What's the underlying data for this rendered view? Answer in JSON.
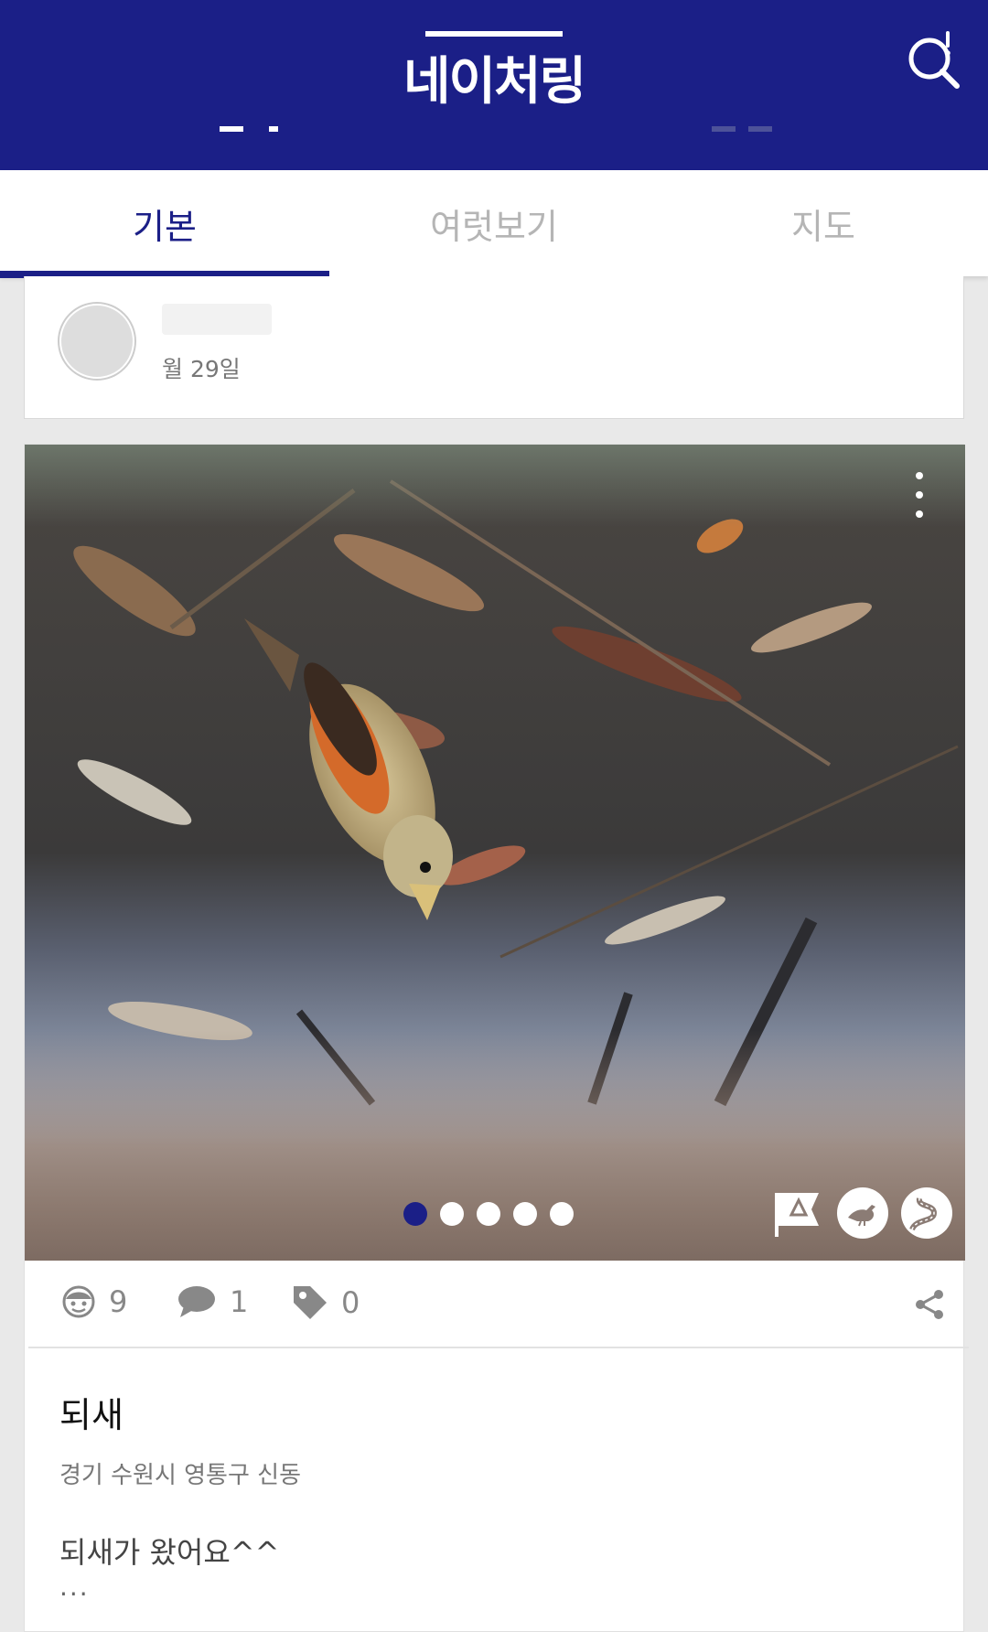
{
  "header": {
    "logo_text": "네이처링",
    "search_label": "search"
  },
  "tabs": [
    {
      "label": "기본",
      "active": true
    },
    {
      "label": "여럿보기",
      "active": false
    },
    {
      "label": "지도",
      "active": false
    }
  ],
  "author": {
    "date": "월 29일"
  },
  "post": {
    "species": "되새",
    "location": "경기 수원시 영통구 신동",
    "description": "되새가 왔어요^^",
    "ellipsis": "...",
    "photo_count": 5,
    "photo_index": 1,
    "stats": {
      "likes": "9",
      "comments": "1",
      "tags": "0"
    }
  },
  "colors": {
    "brand": "#1b1f87",
    "inactive_tab": "#b5b5b5"
  }
}
